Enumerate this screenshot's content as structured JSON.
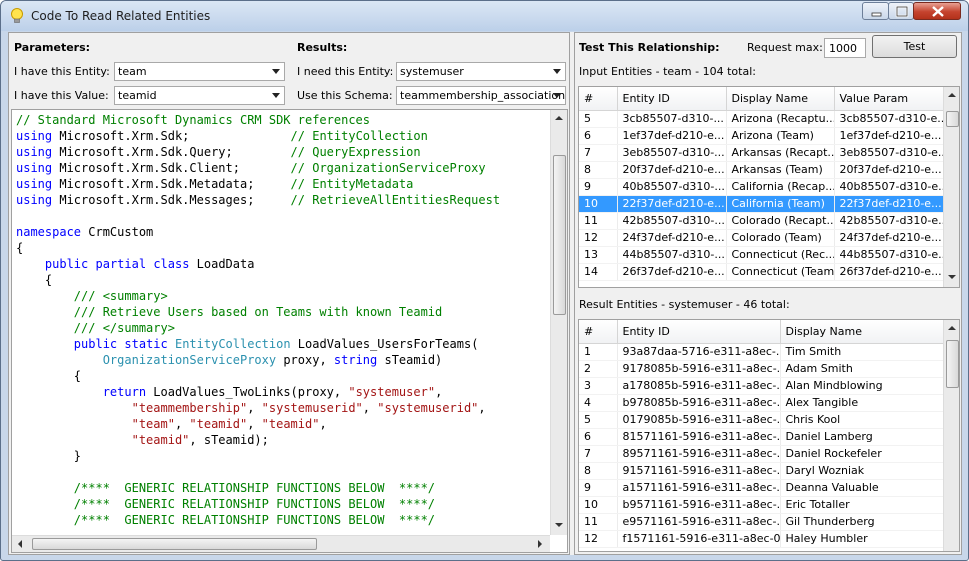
{
  "window": {
    "title": "Code To Read Related Entities",
    "icon": "lightbulb-icon",
    "controls": [
      "minimize-icon",
      "maximize-icon",
      "close-icon"
    ]
  },
  "parameters": {
    "heading": "Parameters:",
    "entity_label": "I have this Entity:",
    "entity_value": "team",
    "value_label": "I have this Value:",
    "value_value": "teamid"
  },
  "results": {
    "heading": "Results:",
    "need_label": "I need this Entity:",
    "need_value": "systemuser",
    "schema_label": "Use this Schema:",
    "schema_value": "teammembership_association"
  },
  "code": {
    "lines": [
      [
        [
          "// Standard Microsoft Dynamics CRM SDK references",
          "c"
        ]
      ],
      [
        [
          "using",
          "k"
        ],
        [
          " Microsoft.Xrm.Sdk;              ",
          ""
        ],
        [
          "// EntityCollection",
          "c"
        ]
      ],
      [
        [
          "using",
          "k"
        ],
        [
          " Microsoft.Xrm.Sdk.Query;        ",
          ""
        ],
        [
          "// QueryExpression",
          "c"
        ]
      ],
      [
        [
          "using",
          "k"
        ],
        [
          " Microsoft.Xrm.Sdk.Client;       ",
          ""
        ],
        [
          "// OrganizationServiceProxy",
          "c"
        ]
      ],
      [
        [
          "using",
          "k"
        ],
        [
          " Microsoft.Xrm.Sdk.Metadata;     ",
          ""
        ],
        [
          "// EntityMetadata",
          "c"
        ]
      ],
      [
        [
          "using",
          "k"
        ],
        [
          " Microsoft.Xrm.Sdk.Messages;     ",
          ""
        ],
        [
          "// RetrieveAllEntitiesRequest",
          "c"
        ]
      ],
      [],
      [
        [
          "namespace",
          "k"
        ],
        [
          " CrmCustom",
          ""
        ]
      ],
      [
        [
          "{",
          ""
        ]
      ],
      [
        [
          "    ",
          ""
        ],
        [
          "public",
          "k"
        ],
        [
          " ",
          ""
        ],
        [
          "partial",
          "k"
        ],
        [
          " ",
          ""
        ],
        [
          "class",
          "k"
        ],
        [
          " LoadData",
          ""
        ]
      ],
      [
        [
          "    {",
          ""
        ]
      ],
      [
        [
          "        /// <summary>",
          "c"
        ]
      ],
      [
        [
          "        /// Retrieve Users based on Teams with known Teamid",
          "c"
        ]
      ],
      [
        [
          "        /// </summary>",
          "c"
        ]
      ],
      [
        [
          "        ",
          ""
        ],
        [
          "public",
          "k"
        ],
        [
          " ",
          ""
        ],
        [
          "static",
          "k"
        ],
        [
          " ",
          ""
        ],
        [
          "EntityCollection",
          "t"
        ],
        [
          " LoadValues_UsersForTeams(",
          ""
        ]
      ],
      [
        [
          "            ",
          ""
        ],
        [
          "OrganizationServiceProxy",
          "t"
        ],
        [
          " proxy, ",
          ""
        ],
        [
          "string",
          "k"
        ],
        [
          " sTeamid)",
          ""
        ]
      ],
      [
        [
          "        {",
          ""
        ]
      ],
      [
        [
          "            ",
          ""
        ],
        [
          "return",
          "k"
        ],
        [
          " LoadValues_TwoLinks(proxy, ",
          ""
        ],
        [
          "\"systemuser\"",
          "s"
        ],
        [
          ",",
          ""
        ]
      ],
      [
        [
          "                ",
          ""
        ],
        [
          "\"teammembership\"",
          "s"
        ],
        [
          ", ",
          ""
        ],
        [
          "\"systemuserid\"",
          "s"
        ],
        [
          ", ",
          ""
        ],
        [
          "\"systemuserid\"",
          "s"
        ],
        [
          ",",
          ""
        ]
      ],
      [
        [
          "                ",
          ""
        ],
        [
          "\"team\"",
          "s"
        ],
        [
          ", ",
          ""
        ],
        [
          "\"teamid\"",
          "s"
        ],
        [
          ", ",
          ""
        ],
        [
          "\"teamid\"",
          "s"
        ],
        [
          ",",
          ""
        ]
      ],
      [
        [
          "                ",
          ""
        ],
        [
          "\"teamid\"",
          "s"
        ],
        [
          ", sTeamid);",
          ""
        ]
      ],
      [
        [
          "        }",
          ""
        ]
      ],
      [],
      [
        [
          "        /****  GENERIC RELATIONSHIP FUNCTIONS BELOW  ****/",
          "c"
        ]
      ],
      [
        [
          "        /****  GENERIC RELATIONSHIP FUNCTIONS BELOW  ****/",
          "c"
        ]
      ],
      [
        [
          "        /****  GENERIC RELATIONSHIP FUNCTIONS BELOW  ****/",
          "c"
        ]
      ]
    ],
    "scroll_icons": [
      "scroll-up-arrow-icon",
      "scroll-down-arrow-icon",
      "scroll-left-arrow-icon",
      "scroll-right-arrow-icon"
    ]
  },
  "test": {
    "heading": "Test This Relationship:",
    "request_max_label": "Request max:",
    "request_max_value": "1000",
    "button_label": "Test"
  },
  "input_entities": {
    "caption": "Input Entities - team - 104 total:",
    "columns": [
      "#",
      "Entity ID",
      "Display Name",
      "Value Param"
    ],
    "selected_index": 5,
    "rows": [
      [
        "5",
        "3cb85507-d310-...",
        "Arizona (Recaptu...",
        "3cb85507-d310-e..."
      ],
      [
        "6",
        "1ef37def-d210-e...",
        "Arizona (Team)",
        "1ef37def-d210-e..."
      ],
      [
        "7",
        "3eb85507-d310-...",
        "Arkansas (Recapt...",
        "3eb85507-d310-e..."
      ],
      [
        "8",
        "20f37def-d210-e...",
        "Arkansas (Team)",
        "20f37def-d210-e..."
      ],
      [
        "9",
        "40b85507-d310-...",
        "California (Recap...",
        "40b85507-d310-e..."
      ],
      [
        "10",
        "22f37def-d210-e...",
        "California (Team)",
        "22f37def-d210-e..."
      ],
      [
        "11",
        "42b85507-d310-...",
        "Colorado (Recapt...",
        "42b85507-d310-e..."
      ],
      [
        "12",
        "24f37def-d210-e...",
        "Colorado (Team)",
        "24f37def-d210-e..."
      ],
      [
        "13",
        "44b85507-d310-...",
        "Connecticut (Rec...",
        "44b85507-d310-e..."
      ],
      [
        "14",
        "26f37def-d210-e...",
        "Connecticut (Team)",
        "26f37def-d210-e..."
      ]
    ]
  },
  "result_entities": {
    "caption": "Result Entities - systemuser - 46 total:",
    "columns": [
      "#",
      "Entity ID",
      "Display Name"
    ],
    "rows": [
      [
        "1",
        "93a87daa-5716-e311-a8ec-...",
        "Tim Smith"
      ],
      [
        "2",
        "9178085b-5916-e311-a8ec-...",
        "Adam Smith"
      ],
      [
        "3",
        "a178085b-5916-e311-a8ec-...",
        "Alan Mindblowing"
      ],
      [
        "4",
        "b978085b-5916-e311-a8ec-...",
        "Alex Tangible"
      ],
      [
        "5",
        "0179085b-5916-e311-a8ec-...",
        "Chris Kool"
      ],
      [
        "6",
        "81571161-5916-e311-a8ec-...",
        "Daniel Lamberg"
      ],
      [
        "7",
        "89571161-5916-e311-a8ec-...",
        "Daniel Rockefeler"
      ],
      [
        "8",
        "91571161-5916-e311-a8ec-...",
        "Daryl Wozniak"
      ],
      [
        "9",
        "a1571161-5916-e311-a8ec-...",
        "Deanna Valuable"
      ],
      [
        "10",
        "b9571161-5916-e311-a8ec-...",
        "Eric Totaller"
      ],
      [
        "11",
        "e9571161-5916-e311-a8ec-...",
        "Gil Thunderberg"
      ],
      [
        "12",
        "f1571161-5916-e311-a8ec-0...",
        "Haley Humbler"
      ]
    ]
  }
}
